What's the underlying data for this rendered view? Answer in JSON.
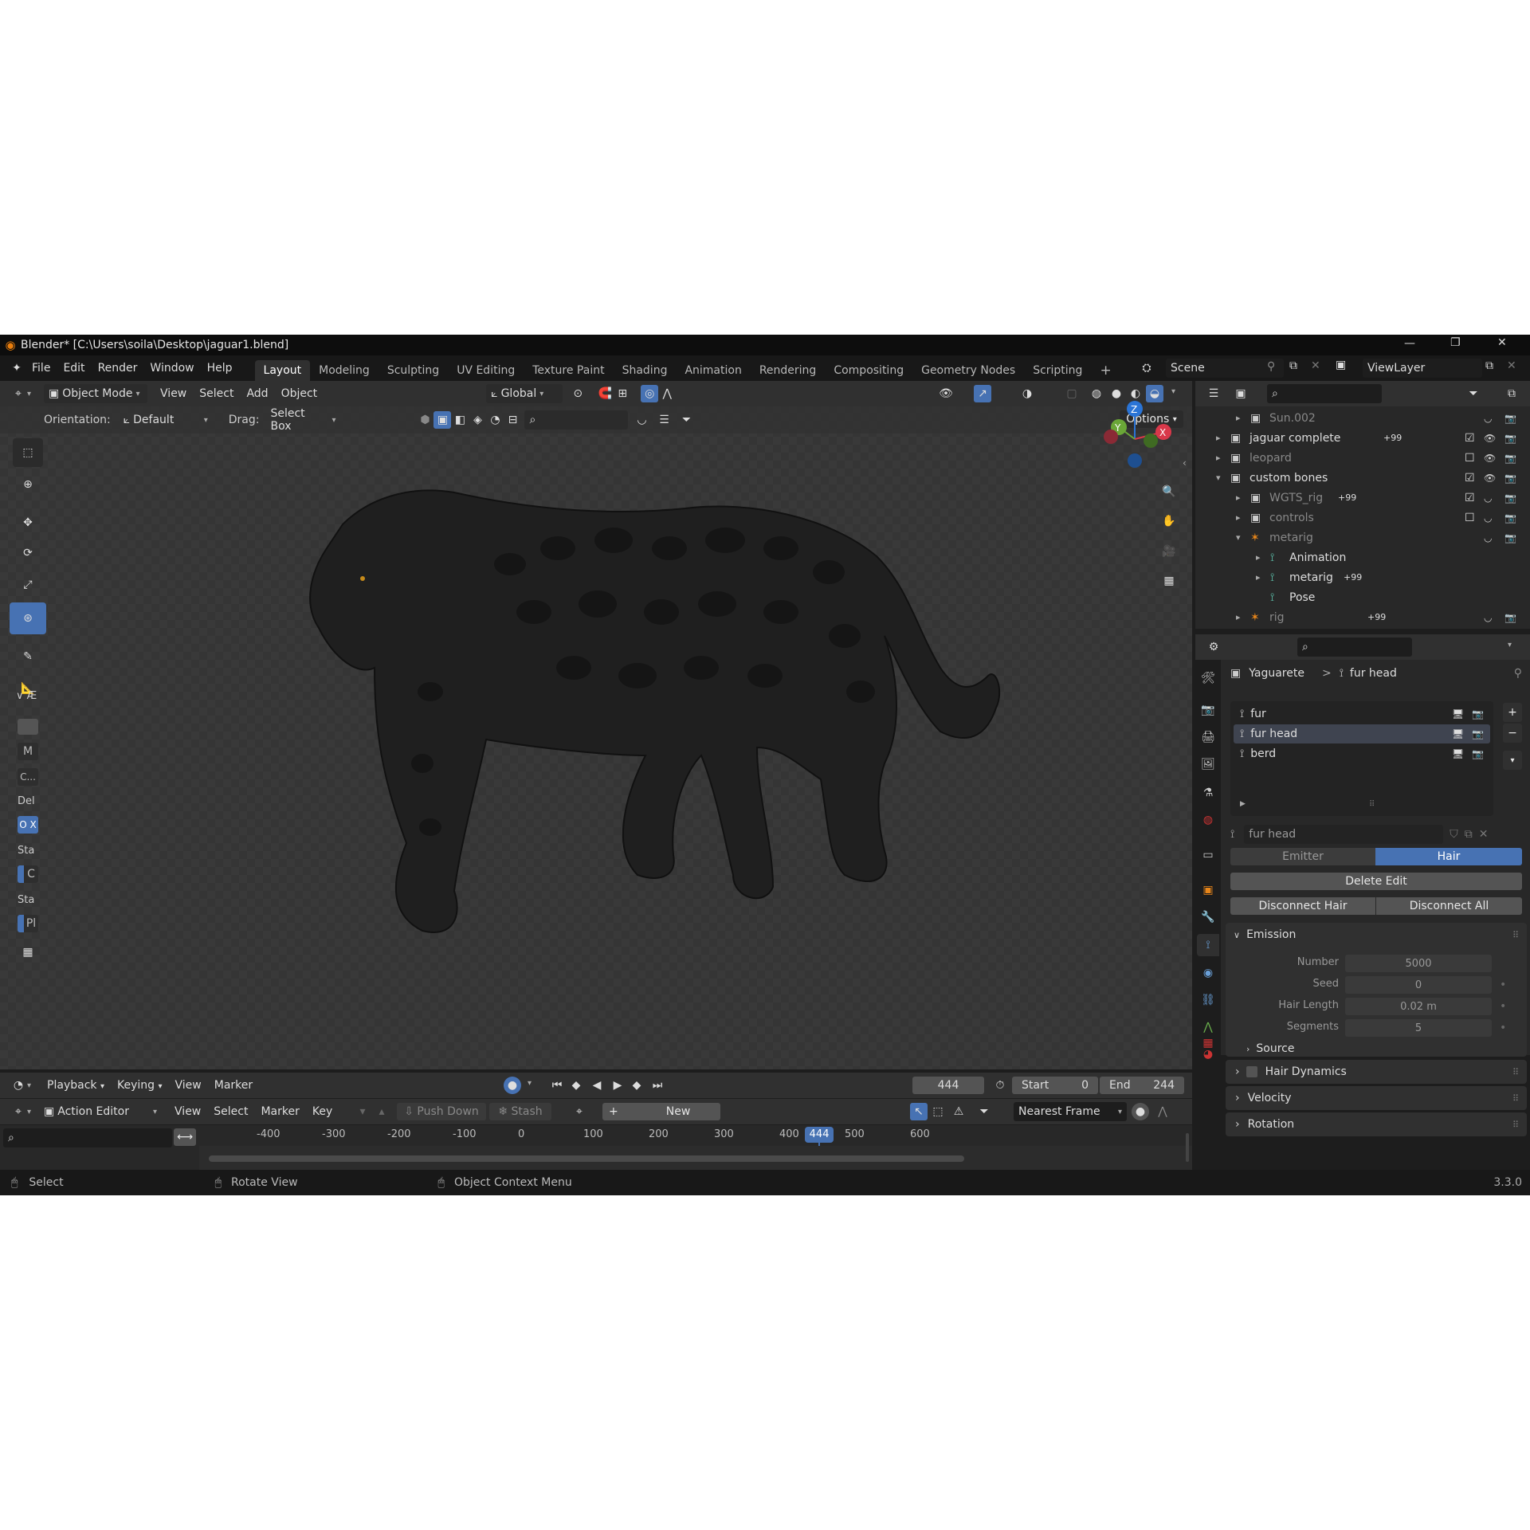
{
  "titlebar": {
    "title": "Blender* [C:\\Users\\soila\\Desktop\\jaguar1.blend]",
    "minimize": "—",
    "restore": "❐",
    "close": "✕"
  },
  "menubar": {
    "items": [
      "File",
      "Edit",
      "Render",
      "Window",
      "Help"
    ],
    "workspaces": [
      "Layout",
      "Modeling",
      "Sculpting",
      "UV Editing",
      "Texture Paint",
      "Shading",
      "Animation",
      "Rendering",
      "Compositing",
      "Geometry Nodes",
      "Scripting"
    ],
    "active_workspace": "Layout",
    "add_workspace": "+",
    "scene": "Scene",
    "view_layer": "ViewLayer"
  },
  "viewport_header": {
    "mode": "Object Mode",
    "menus": [
      "View",
      "Select",
      "Add",
      "Object"
    ],
    "transform_orientation": "Global",
    "orientation_label": "Orientation:",
    "orientation_value": "Default",
    "drag_label": "Drag:",
    "drag_value": "Select Box",
    "options": "Options"
  },
  "toolbar_sidebar": {
    "header": "Æ",
    "labels": [
      "M",
      "C...",
      "Del",
      "O X",
      "Sta",
      "C",
      "Sta",
      "Pl"
    ]
  },
  "outliner": {
    "rows": [
      {
        "name": "Sun.002",
        "indent": 1,
        "dim": true
      },
      {
        "name": "jaguar complete",
        "indent": 0,
        "badge": "99"
      },
      {
        "name": "leopard",
        "indent": 0,
        "dim": true
      },
      {
        "name": "custom bones",
        "indent": 0
      },
      {
        "name": "WGTS_rig",
        "indent": 1,
        "dim": true,
        "badge": "99"
      },
      {
        "name": "controls",
        "indent": 1,
        "dim": true
      },
      {
        "name": "metarig",
        "indent": 1,
        "dim": true
      },
      {
        "name": "Animation",
        "indent": 2
      },
      {
        "name": "metarig",
        "indent": 2,
        "badge": "99"
      },
      {
        "name": "Pose",
        "indent": 2
      },
      {
        "name": "rig",
        "indent": 1,
        "dim": true,
        "badge": "99"
      }
    ],
    "badge_prefix": "+"
  },
  "properties": {
    "breadcrumb_object": "Yaguarete",
    "breadcrumb_sep": ">",
    "breadcrumb_system": "fur head",
    "particle_list": [
      "fur",
      "fur head",
      "berd"
    ],
    "selected_index": 1,
    "settings_name": "fur head",
    "type_buttons": [
      "Emitter",
      "Hair"
    ],
    "active_type": "Hair",
    "delete_edit": "Delete Edit",
    "disconnect_hair": "Disconnect Hair",
    "disconnect_all": "Disconnect All",
    "emission_panel": "Emission",
    "fields": [
      {
        "label": "Number",
        "value": "5000"
      },
      {
        "label": "Seed",
        "value": "0"
      },
      {
        "label": "Hair Length",
        "value": "0.02 m"
      },
      {
        "label": "Segments",
        "value": "5"
      }
    ],
    "source_panel": "Source",
    "panels": [
      "Hair Dynamics",
      "Velocity",
      "Rotation"
    ]
  },
  "timeline": {
    "menus": [
      "Playback",
      "Keying",
      "View",
      "Marker"
    ],
    "current_frame": "444",
    "start_label": "Start",
    "start_value": "0",
    "end_label": "End",
    "end_value": "244"
  },
  "action_editor": {
    "mode": "Action Editor",
    "menus": [
      "View",
      "Select",
      "Marker",
      "Key"
    ],
    "push_down": "Push Down",
    "stash": "Stash",
    "new": "New",
    "snap": "Nearest Frame",
    "ruler_ticks": [
      "-400",
      "-300",
      "-200",
      "-100",
      "0",
      "100",
      "200",
      "300",
      "400",
      "500",
      "600"
    ],
    "ruler_values": [
      -400,
      -300,
      -200,
      -100,
      0,
      100,
      200,
      300,
      400,
      500,
      600
    ],
    "playhead_value": 444,
    "playhead_label": "444"
  },
  "statusbar": {
    "select": "Select",
    "rotate": "Rotate View",
    "context": "Object Context Menu",
    "version": "3.3.0"
  },
  "colors": {
    "accent": "#4772b3",
    "axis_x": "#d9384a",
    "axis_y": "#6aa637",
    "axis_z": "#2a74d6"
  }
}
